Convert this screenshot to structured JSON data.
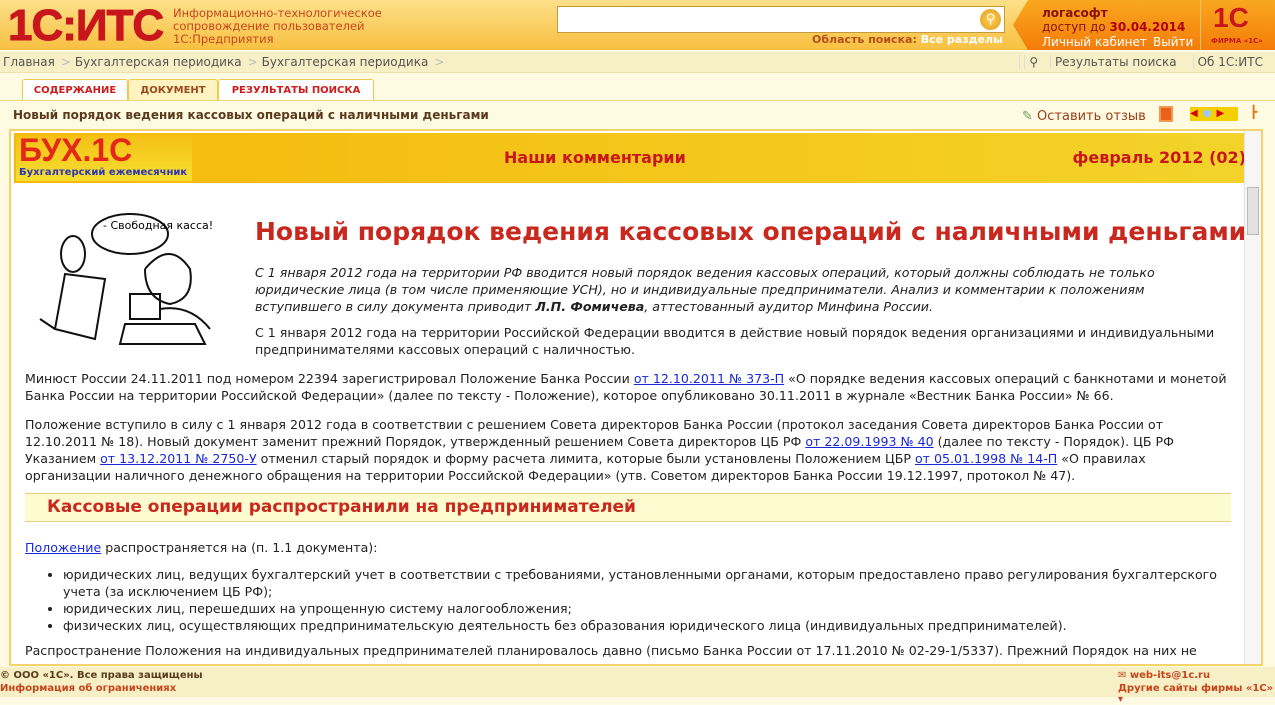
{
  "header": {
    "logo": "1С:ИТС",
    "logo_sub": [
      "Информационно-технологическое",
      "сопровождение пользователей",
      "1С:Предприятия"
    ],
    "search_value": "",
    "search_scope_label": "Область поиска:",
    "search_scope_value": "Все разделы",
    "user": "логасофт",
    "access_label": "доступ до",
    "access_date": "30.04.2014",
    "cabinet": "Личный кабинет",
    "logout": "Выйти",
    "firm_logo": "1С",
    "firm_label": "ФИРМА «1С»"
  },
  "breadcrumbs": [
    "Главная",
    "Бухгалтерская периодика",
    "Бухгалтерская периодика"
  ],
  "top_links": {
    "search_results": "Результаты поиска",
    "about": "Об 1С:ИТС"
  },
  "tabs": [
    {
      "label": "СОДЕРЖАНИЕ"
    },
    {
      "label": "ДОКУМЕНТ"
    },
    {
      "label": "РЕЗУЛЬТАТЫ ПОИСКА"
    }
  ],
  "doc_title": "Новый порядок ведения кассовых операций с наличными деньгами",
  "toolbar": {
    "feedback": "Оставить отзыв"
  },
  "banner": {
    "logo": "БУХ.1С",
    "logo_sub": "Бухгалтерский ежемесячник",
    "section": "Наши комментарии",
    "issue": "февраль 2012 (02)"
  },
  "article": {
    "cartoon_caption": "- Свободная касса!",
    "title": "Новый порядок ведения кассовых операций с наличными деньгами",
    "lead_a": "С 1 января 2012 года на территории РФ вводится новый порядок ведения кассовых операций, который должны соблюдать не только юридические лица (в том числе применяющие УСН), но и индивидуальные предприниматели. Анализ и комментарии к положениям вступившего в силу документа приводит ",
    "lead_author": "Л.П. Фомичева",
    "lead_b": ", аттестованный аудитор Минфина России.",
    "p0": "С 1 января 2012 года на территории Российской Федерации вводится в действие новый порядок ведения организациями и индивидуальными предпринимателями кассовых операций с наличностью.",
    "p1a": "Минюст России 24.11.2011 под номером 22394 зарегистрировал Положение Банка России ",
    "p1link": "от 12.10.2011 № 373-П",
    "p1b": " «О порядке ведения кассовых операций с банкнотами и монетой Банка России на территории Российской Федерации» (далее по тексту - Положение), которое опубликовано 30.11.2011 в журнале «Вестник Банка России» № 66.",
    "p2a": "Положение вступило в силу с 1 января 2012 года в соответствии с решением Совета директоров Банка России (протокол заседания Совета директоров Банка России от 12.10.2011 № 18). Новый документ заменит прежний Порядок, утвержденный решением Совета директоров ЦБ РФ ",
    "p2link1": "от 22.09.1993 № 40",
    "p2b": " (далее по тексту - Порядок). ЦБ РФ Указанием ",
    "p2link2": "от 13.12.2011 № 2750-У",
    "p2c": " отменил старый порядок и форму расчета лимита, которые были установлены Положением ЦБР ",
    "p2link3": "от 05.01.1998 № 14-П",
    "p2d": " «О правилах организации наличного денежного обращения на территории Российской Федерации» (утв. Советом директоров Банка России 19.12.1997, протокол № 47).",
    "h2": "Кассовые операции распространили на предпринимателей",
    "p3link": "Положение",
    "p3": " распространяется на (п. 1.1 документа):",
    "bullets": [
      "юридических лиц, ведущих бухгалтерский учет в соответствии с требованиями, установленными органами, которым предоставлено право регулирования бухгалтерского учета (за исключением ЦБ РФ);",
      "юридических лиц, перешедших на упрощенную систему налогообложения;",
      "физических лиц, осуществляющих предпринимательскую деятельность без образования юридического лица (индивидуальных предпринимателей)."
    ],
    "p4": "Распространение Положения на индивидуальных предпринимателей планировалось давно (письмо Банка России от 17.11.2010 № 02-29-1/5337). Прежний Порядок на них не"
  },
  "footer": {
    "copyright": "© ООО «1С». Все права защищены",
    "restrictions": "Информация об ограничениях",
    "email": "web-its@1c.ru",
    "other_sites": "Другие сайты фирмы «1С» ▾"
  }
}
